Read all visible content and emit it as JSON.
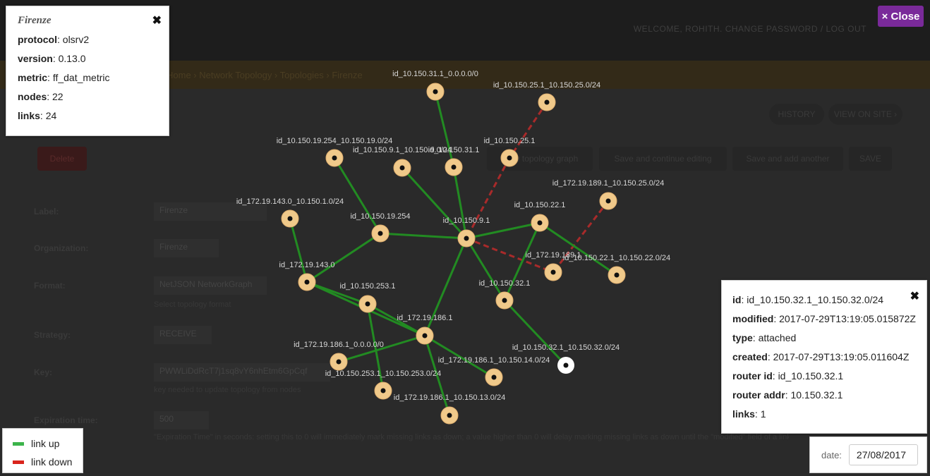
{
  "background": {
    "welcome": "WELCOME, ROHITH. CHANGE PASSWORD / LOG OUT",
    "breadcrumbs": "Home › Network Topology › Topologies › Firenze",
    "buttons": {
      "history": "HISTORY",
      "view_on_site": "VIEW ON SITE ›",
      "delete": "Delete",
      "view_topology": "View topology graph",
      "save_continue": "Save and continue editing",
      "save_add": "Save and add another",
      "save": "SAVE"
    },
    "labels": {
      "label": "Label:",
      "organization": "Organization:",
      "format": "Format:",
      "strategy": "Strategy:",
      "key": "Key:",
      "expiration": "Expiration time:"
    },
    "values": {
      "label": "Firenze",
      "organization": "Firenze",
      "format": "NetJSON NetworkGraph",
      "strategy": "RECEIVE",
      "key": "PWWLiDdRcT7j1sq8vY6nhEtm6GpCqf",
      "expiration": "500"
    },
    "help": {
      "format": "Select topology format",
      "key": "key needed to update topology from nodes",
      "expiration": "\"Expiration Time\" in seconds: setting this to 0 will immediately mark missing links as down; a value higher than 0 will delay marking missing links as down until the \"modified\" field of a link is older than \"Expiration Time\""
    }
  },
  "close_button": "× Close",
  "topology": {
    "title": "Firenze",
    "close_icon": "✖",
    "rows": [
      {
        "key": "protocol",
        "value": "olsrv2"
      },
      {
        "key": "version",
        "value": "0.13.0"
      },
      {
        "key": "metric",
        "value": "ff_dat_metric"
      },
      {
        "key": "nodes",
        "value": "22"
      },
      {
        "key": "links",
        "value": "24"
      }
    ]
  },
  "node_info": {
    "close_icon": "✖",
    "rows": [
      {
        "key": "id",
        "value": "id_10.150.32.1_10.150.32.0/24"
      },
      {
        "key": "modified",
        "value": "2017-07-29T13:19:05.015872Z"
      },
      {
        "key": "type",
        "value": "attached"
      },
      {
        "key": "created",
        "value": "2017-07-29T13:19:05.011604Z"
      },
      {
        "key": "router id",
        "value": "id_10.150.32.1"
      },
      {
        "key": "router addr",
        "value": "10.150.32.1"
      },
      {
        "key": "links",
        "value": "1"
      }
    ]
  },
  "legend": {
    "up": "link up",
    "down": "link down",
    "up_color": "#3bb44a",
    "down_color": "#d9241c"
  },
  "date": {
    "label": "date:",
    "value": "27/08/2017"
  },
  "nodes": [
    {
      "id": "id_10.150.31.1_0.0.0.0/0"
    },
    {
      "id": "id_10.150.25.1_10.150.25.0/24"
    },
    {
      "id": "id_10.150.19.254_10.150.19.0/24"
    },
    {
      "id": "id_10.150.9.1_10.150.9.0/24"
    },
    {
      "id": "id_10.150.31.1"
    },
    {
      "id": "id_10.150.25.1"
    },
    {
      "id": "id_172.19.189.1_10.150.25.0/24"
    },
    {
      "id": "id_172.19.143.0_10.150.1.0/24"
    },
    {
      "id": "id_10.150.19.254"
    },
    {
      "id": "id_10.150.9.1"
    },
    {
      "id": "id_10.150.22.1"
    },
    {
      "id": "id_172.19.189.1"
    },
    {
      "id": "id_10.150.22.1_10.150.22.0/24"
    },
    {
      "id": "id_172.19.143.0"
    },
    {
      "id": "id_10.150.253.1"
    },
    {
      "id": "id_10.150.32.1"
    },
    {
      "id": "id_172.19.186.1"
    },
    {
      "id": "id_10.150.32.1_10.150.32.0/24",
      "selected": true
    },
    {
      "id": "id_172.19.186.1_0.0.0.0/0"
    },
    {
      "id": "id_172.19.186.1_10.150.14.0/24"
    },
    {
      "id": "id_10.150.253.1_10.150.253.0/24"
    },
    {
      "id": "id_172.19.186.1_10.150.13.0/24"
    }
  ],
  "links": [
    {
      "source": "id_10.150.31.1_0.0.0.0/0",
      "target": "id_10.150.31.1",
      "status": "up"
    },
    {
      "source": "id_10.150.25.1_10.150.25.0/24",
      "target": "id_10.150.25.1",
      "status": "down"
    },
    {
      "source": "id_10.150.25.1",
      "target": "id_10.150.9.1",
      "status": "down"
    },
    {
      "source": "id_10.150.19.254_10.150.19.0/24",
      "target": "id_10.150.19.254",
      "status": "up"
    },
    {
      "source": "id_10.150.9.1_10.150.9.0/24",
      "target": "id_10.150.9.1",
      "status": "up"
    },
    {
      "source": "id_10.150.31.1",
      "target": "id_10.150.9.1",
      "status": "up"
    },
    {
      "source": "id_10.150.19.254",
      "target": "id_10.150.9.1",
      "status": "up"
    },
    {
      "source": "id_10.150.9.1",
      "target": "id_10.150.22.1",
      "status": "up"
    },
    {
      "source": "id_10.150.9.1",
      "target": "id_172.19.189.1",
      "status": "down"
    },
    {
      "source": "id_172.19.189.1_10.150.25.0/24",
      "target": "id_172.19.189.1",
      "status": "down"
    },
    {
      "source": "id_10.150.22.1",
      "target": "id_10.150.22.1_10.150.22.0/24",
      "status": "up"
    },
    {
      "source": "id_10.150.22.1",
      "target": "id_10.150.32.1",
      "status": "up"
    },
    {
      "source": "id_10.150.9.1",
      "target": "id_10.150.32.1",
      "status": "up"
    },
    {
      "source": "id_10.150.9.1",
      "target": "id_172.19.186.1",
      "status": "up"
    },
    {
      "source": "id_10.150.32.1",
      "target": "id_10.150.32.1_10.150.32.0/24",
      "status": "up"
    },
    {
      "source": "id_172.19.143.0_10.150.1.0/24",
      "target": "id_172.19.143.0",
      "status": "up"
    },
    {
      "source": "id_10.150.19.254",
      "target": "id_172.19.143.0",
      "status": "up"
    },
    {
      "source": "id_172.19.143.0",
      "target": "id_10.150.253.1",
      "status": "up"
    },
    {
      "source": "id_172.19.143.0",
      "target": "id_172.19.186.1",
      "status": "up"
    },
    {
      "source": "id_10.150.253.1",
      "target": "id_172.19.186.1",
      "status": "up"
    },
    {
      "source": "id_10.150.253.1",
      "target": "id_10.150.253.1_10.150.253.0/24",
      "status": "up"
    },
    {
      "source": "id_172.19.186.1",
      "target": "id_172.19.186.1_0.0.0.0/0",
      "status": "up"
    },
    {
      "source": "id_172.19.186.1",
      "target": "id_172.19.186.1_10.150.14.0/24",
      "status": "up"
    },
    {
      "source": "id_172.19.186.1",
      "target": "id_172.19.186.1_10.150.13.0/24",
      "status": "up"
    }
  ]
}
